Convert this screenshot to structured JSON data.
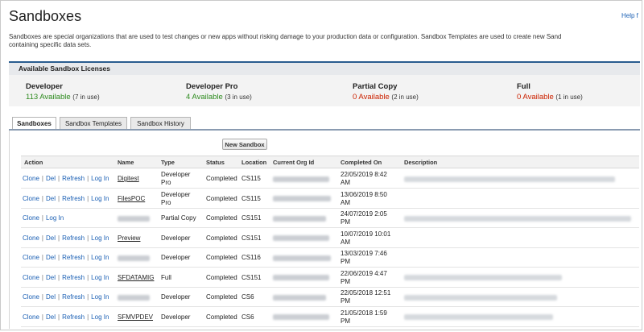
{
  "page": {
    "title": "Sandboxes",
    "help_link": "Help f",
    "intro_line1": "Sandboxes are special organizations that are used to test changes or new apps without risking damage to your production data or configuration. Sandbox Templates are used to create new Sand",
    "intro_line2": "containing specific data sets."
  },
  "licenses": {
    "header": "Available Sandbox Licenses",
    "items": [
      {
        "name": "Developer",
        "available": "113 Available",
        "in_use": "(7 in use)",
        "color": "#2e8b1f"
      },
      {
        "name": "Developer Pro",
        "available": "4 Available",
        "in_use": "(3 in use)",
        "color": "#2e8b1f"
      },
      {
        "name": "Partial Copy",
        "available": "0 Available",
        "in_use": "(2 in use)",
        "color": "#cc2200"
      },
      {
        "name": "Full",
        "available": "0 Available",
        "in_use": "(1 in use)",
        "color": "#cc2200"
      }
    ]
  },
  "tabs": [
    {
      "label": "Sandboxes",
      "active": true
    },
    {
      "label": "Sandbox Templates",
      "active": false
    },
    {
      "label": "Sandbox History",
      "active": false
    }
  ],
  "new_sandbox_button": "New Sandbox",
  "table": {
    "columns": [
      "Action",
      "Name",
      "Type",
      "Status",
      "Location",
      "Current Org Id",
      "Completed On",
      "Description"
    ],
    "action_labels": {
      "clone": "Clone",
      "del": "Del",
      "refresh": "Refresh",
      "login": "Log In",
      "sep": "|"
    },
    "rows": [
      {
        "actions": "full",
        "name": "Digitest",
        "type_l1": "Developer",
        "type_l2": "Pro",
        "status": "Completed",
        "location": "CS115",
        "completed_l1": "22/05/2019 8:42",
        "completed_l2": "AM",
        "name_blurred": false
      },
      {
        "actions": "full",
        "name": "FilesPOC",
        "type_l1": "Developer",
        "type_l2": "Pro",
        "status": "Completed",
        "location": "CS115",
        "completed_l1": "13/06/2019 8:50",
        "completed_l2": "AM",
        "name_blurred": false
      },
      {
        "actions": "short",
        "name": "",
        "type_l1": "Partial Copy",
        "type_l2": "",
        "status": "Completed",
        "location": "CS151",
        "completed_l1": "24/07/2019 2:05",
        "completed_l2": "PM",
        "name_blurred": true
      },
      {
        "actions": "full",
        "name": "Preview",
        "type_l1": "Developer",
        "type_l2": "",
        "status": "Completed",
        "location": "CS151",
        "completed_l1": "10/07/2019 10:01",
        "completed_l2": "AM",
        "name_blurred": false
      },
      {
        "actions": "full",
        "name": "",
        "type_l1": "Developer",
        "type_l2": "",
        "status": "Completed",
        "location": "CS116",
        "completed_l1": "13/03/2019 7:46",
        "completed_l2": "PM",
        "name_blurred": true
      },
      {
        "actions": "full",
        "name": "SFDATAMIG",
        "type_l1": "Full",
        "type_l2": "",
        "status": "Completed",
        "location": "CS151",
        "completed_l1": "22/06/2019 4:47",
        "completed_l2": "PM",
        "name_blurred": false
      },
      {
        "actions": "full",
        "name": "",
        "type_l1": "Developer",
        "type_l2": "",
        "status": "Completed",
        "location": "CS6",
        "completed_l1": "22/05/2018 12:51",
        "completed_l2": "PM",
        "name_blurred": true
      },
      {
        "actions": "full",
        "name": "SFMVPDEV",
        "type_l1": "Developer",
        "type_l2": "",
        "status": "Completed",
        "location": "CS6",
        "completed_l1": "21/05/2018 1:59",
        "completed_l2": "PM",
        "name_blurred": false
      }
    ]
  }
}
